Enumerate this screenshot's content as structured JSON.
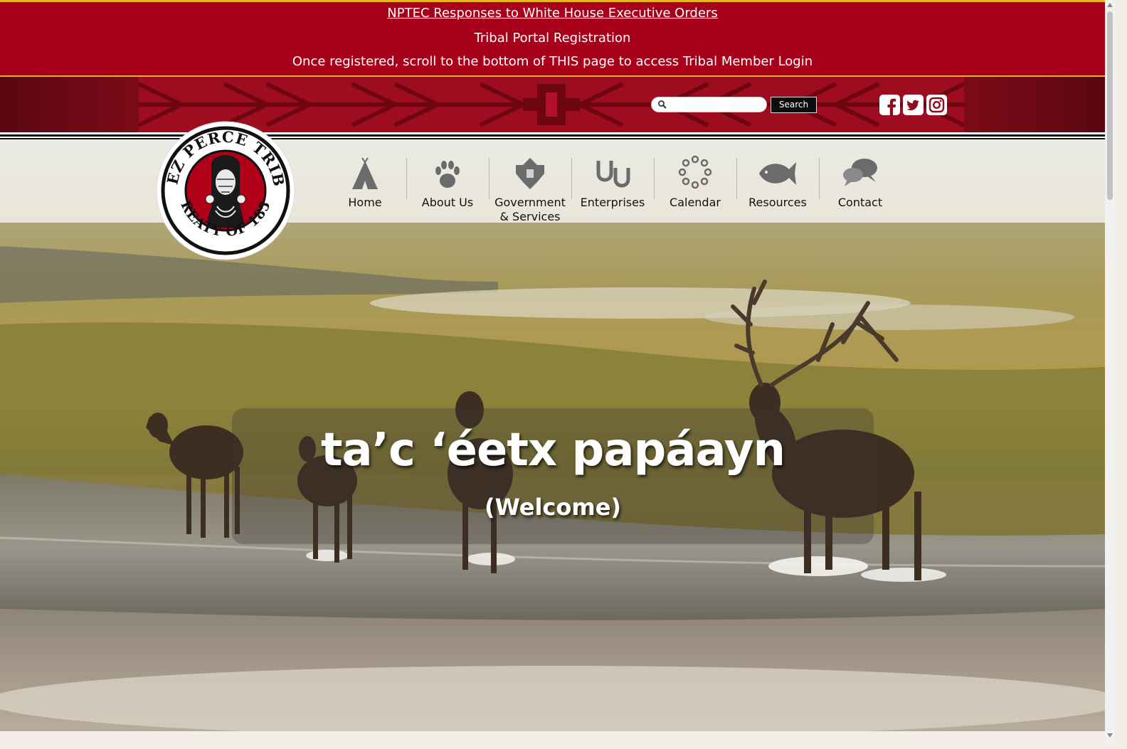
{
  "announcement": {
    "link1": "NPTEC Responses to White House Executive Orders",
    "link2": "Tribal Portal Registration",
    "notice": "Once registered, scroll to the bottom of THIS page to access Tribal Member Login"
  },
  "search": {
    "placeholder": "",
    "button_label": "Search",
    "icon": "search-icon"
  },
  "social": [
    {
      "name": "facebook-icon"
    },
    {
      "name": "twitter-icon"
    },
    {
      "name": "instagram-icon"
    }
  ],
  "logo": {
    "top_text": "NEZ PERCE TRIBE",
    "bottom_text": "TREATY OF 1855"
  },
  "nav": {
    "items": [
      {
        "label": "Home",
        "icon": "tipi-icon"
      },
      {
        "label": "About Us",
        "icon": "paw-print-icon"
      },
      {
        "label": "Government & Services",
        "icon": "beadwork-icon"
      },
      {
        "label": "Enterprises",
        "icon": "horseshoes-icon"
      },
      {
        "label": "Calendar",
        "icon": "circle-dots-icon"
      },
      {
        "label": "Resources",
        "icon": "fish-icon"
      },
      {
        "label": "Contact",
        "icon": "speech-bubbles-icon"
      }
    ]
  },
  "hero": {
    "title": "ta’c ‘éetx papáayn",
    "subtitle": "(Welcome)"
  },
  "colors": {
    "announcement_bg": "#a8001a",
    "accent_gold": "#e6b422",
    "band_red": "#8e0a1c"
  }
}
